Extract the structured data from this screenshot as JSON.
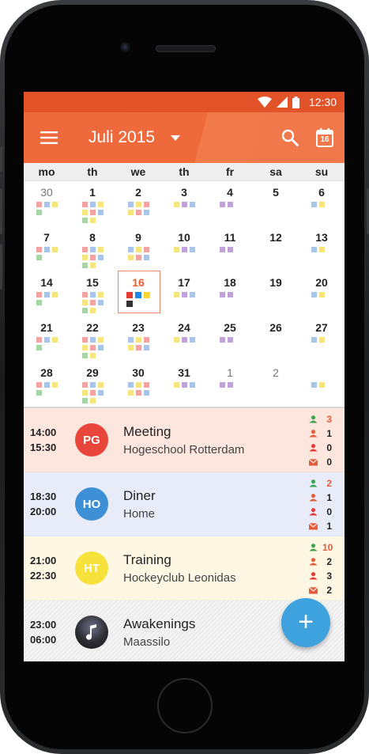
{
  "status": {
    "time": "12:30"
  },
  "appbar": {
    "title": "Juli 2015",
    "calendar_icon_day": "16"
  },
  "weekdays": [
    "mo",
    "th",
    "we",
    "th",
    "fr",
    "sa",
    "su"
  ],
  "colors": {
    "Y": "#f6e47d",
    "P": "#bfa3d9",
    "B": "#a8c4e8",
    "R": "#f4a3a3",
    "G": "#a6d6a6",
    "O": "#f7c891"
  },
  "days": [
    {
      "n": "30",
      "o": true,
      "d": [
        "R",
        "B",
        "Y",
        "G"
      ]
    },
    {
      "n": "1",
      "d": [
        "R",
        "B",
        "Y",
        "Y",
        "R",
        "B",
        "G",
        "Y"
      ]
    },
    {
      "n": "2",
      "d": [
        "B",
        "Y",
        "R",
        "Y",
        "R",
        "B"
      ]
    },
    {
      "n": "3",
      "d": [
        "Y",
        "P",
        "B"
      ]
    },
    {
      "n": "4",
      "d": [
        "P",
        "P"
      ]
    },
    {
      "n": "5",
      "d": []
    },
    {
      "n": "6",
      "d": [
        "B",
        "Y"
      ]
    },
    {
      "n": "7",
      "d": [
        "R",
        "B",
        "Y",
        "G"
      ]
    },
    {
      "n": "8",
      "d": [
        "R",
        "B",
        "Y",
        "Y",
        "R",
        "B",
        "G",
        "Y"
      ]
    },
    {
      "n": "9",
      "d": [
        "B",
        "Y",
        "R",
        "Y",
        "R",
        "B"
      ]
    },
    {
      "n": "10",
      "d": [
        "Y",
        "P",
        "B"
      ]
    },
    {
      "n": "11",
      "d": [
        "P",
        "P"
      ]
    },
    {
      "n": "12",
      "d": []
    },
    {
      "n": "13",
      "d": [
        "B",
        "Y"
      ]
    },
    {
      "n": "14",
      "d": [
        "R",
        "B",
        "Y",
        "G"
      ]
    },
    {
      "n": "15",
      "d": [
        "R",
        "B",
        "Y",
        "Y",
        "R",
        "B",
        "G",
        "Y"
      ]
    },
    {
      "n": "16",
      "t": true,
      "d": [
        "#e53935",
        "#1e88e5",
        "#fdd835",
        "#333333"
      ]
    },
    {
      "n": "17",
      "d": [
        "Y",
        "P",
        "B"
      ]
    },
    {
      "n": "18",
      "d": [
        "P",
        "P"
      ]
    },
    {
      "n": "19",
      "d": []
    },
    {
      "n": "20",
      "d": [
        "B",
        "Y"
      ]
    },
    {
      "n": "21",
      "d": [
        "R",
        "B",
        "Y",
        "G"
      ]
    },
    {
      "n": "22",
      "d": [
        "R",
        "B",
        "Y",
        "Y",
        "R",
        "B",
        "G",
        "Y"
      ]
    },
    {
      "n": "23",
      "d": [
        "B",
        "Y",
        "R",
        "Y",
        "R",
        "B"
      ]
    },
    {
      "n": "24",
      "d": [
        "Y",
        "P",
        "B"
      ]
    },
    {
      "n": "25",
      "d": [
        "P",
        "P"
      ]
    },
    {
      "n": "26",
      "d": []
    },
    {
      "n": "27",
      "d": [
        "B",
        "Y"
      ]
    },
    {
      "n": "28",
      "d": [
        "R",
        "B",
        "Y",
        "G"
      ]
    },
    {
      "n": "29",
      "d": [
        "R",
        "B",
        "Y",
        "Y",
        "R",
        "B",
        "G",
        "Y"
      ]
    },
    {
      "n": "30",
      "d": [
        "B",
        "Y",
        "R",
        "Y",
        "R",
        "B"
      ]
    },
    {
      "n": "31",
      "d": [
        "Y",
        "P",
        "B"
      ]
    },
    {
      "n": "1",
      "o": true,
      "d": [
        "P",
        "P"
      ]
    },
    {
      "n": "2",
      "o": true,
      "d": []
    },
    {
      "n": "",
      "o": true,
      "d": [
        "B",
        "Y"
      ]
    }
  ],
  "count_icon_colors": [
    "#3fa34d",
    "#e35d3a",
    "#e53935",
    "#e35d3a"
  ],
  "events": [
    {
      "start": "14:00",
      "end": "15:30",
      "initials": "PG",
      "avatar_color": "#e8463a",
      "title": "Meeting",
      "subtitle": "Hogeschool Rotterdam",
      "bg": "#fce6de",
      "counts": [
        "3",
        "1",
        "0",
        "0"
      ],
      "first_count_color": "#e35d3a"
    },
    {
      "start": "18:30",
      "end": "20:00",
      "initials": "HO",
      "avatar_color": "#3d8fd6",
      "title": "Diner",
      "subtitle": "Home",
      "bg": "#e8ecf8",
      "counts": [
        "2",
        "1",
        "0",
        "1"
      ],
      "first_count_color": "#e35d3a"
    },
    {
      "start": "21:00",
      "end": "22:30",
      "initials": "HT",
      "avatar_color": "#f7e23b",
      "title": "Training",
      "subtitle": "Hockeyclub Leonidas",
      "bg": "#fdf7e4",
      "counts": [
        "10",
        "2",
        "3",
        "2"
      ],
      "first_count_color": "#e35d3a"
    },
    {
      "start": "23:00",
      "end": "06:00",
      "initials": "",
      "avatar_color": "#2d2d33",
      "title": "Awakenings",
      "subtitle": "Maassilo",
      "bg": "#f3f3f3",
      "counts": [],
      "first_count_color": "#e35d3a"
    }
  ],
  "fab": {
    "label": "+"
  }
}
